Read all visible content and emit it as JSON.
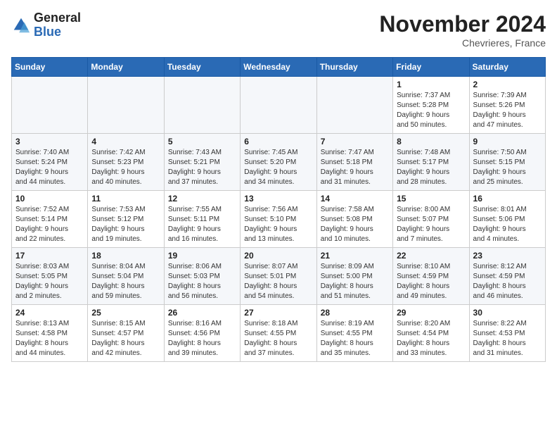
{
  "logo": {
    "general": "General",
    "blue": "Blue"
  },
  "header": {
    "month": "November 2024",
    "location": "Chevrieres, France"
  },
  "weekdays": [
    "Sunday",
    "Monday",
    "Tuesday",
    "Wednesday",
    "Thursday",
    "Friday",
    "Saturday"
  ],
  "weeks": [
    [
      {
        "day": "",
        "info": ""
      },
      {
        "day": "",
        "info": ""
      },
      {
        "day": "",
        "info": ""
      },
      {
        "day": "",
        "info": ""
      },
      {
        "day": "",
        "info": ""
      },
      {
        "day": "1",
        "info": "Sunrise: 7:37 AM\nSunset: 5:28 PM\nDaylight: 9 hours\nand 50 minutes."
      },
      {
        "day": "2",
        "info": "Sunrise: 7:39 AM\nSunset: 5:26 PM\nDaylight: 9 hours\nand 47 minutes."
      }
    ],
    [
      {
        "day": "3",
        "info": "Sunrise: 7:40 AM\nSunset: 5:24 PM\nDaylight: 9 hours\nand 44 minutes."
      },
      {
        "day": "4",
        "info": "Sunrise: 7:42 AM\nSunset: 5:23 PM\nDaylight: 9 hours\nand 40 minutes."
      },
      {
        "day": "5",
        "info": "Sunrise: 7:43 AM\nSunset: 5:21 PM\nDaylight: 9 hours\nand 37 minutes."
      },
      {
        "day": "6",
        "info": "Sunrise: 7:45 AM\nSunset: 5:20 PM\nDaylight: 9 hours\nand 34 minutes."
      },
      {
        "day": "7",
        "info": "Sunrise: 7:47 AM\nSunset: 5:18 PM\nDaylight: 9 hours\nand 31 minutes."
      },
      {
        "day": "8",
        "info": "Sunrise: 7:48 AM\nSunset: 5:17 PM\nDaylight: 9 hours\nand 28 minutes."
      },
      {
        "day": "9",
        "info": "Sunrise: 7:50 AM\nSunset: 5:15 PM\nDaylight: 9 hours\nand 25 minutes."
      }
    ],
    [
      {
        "day": "10",
        "info": "Sunrise: 7:52 AM\nSunset: 5:14 PM\nDaylight: 9 hours\nand 22 minutes."
      },
      {
        "day": "11",
        "info": "Sunrise: 7:53 AM\nSunset: 5:12 PM\nDaylight: 9 hours\nand 19 minutes."
      },
      {
        "day": "12",
        "info": "Sunrise: 7:55 AM\nSunset: 5:11 PM\nDaylight: 9 hours\nand 16 minutes."
      },
      {
        "day": "13",
        "info": "Sunrise: 7:56 AM\nSunset: 5:10 PM\nDaylight: 9 hours\nand 13 minutes."
      },
      {
        "day": "14",
        "info": "Sunrise: 7:58 AM\nSunset: 5:08 PM\nDaylight: 9 hours\nand 10 minutes."
      },
      {
        "day": "15",
        "info": "Sunrise: 8:00 AM\nSunset: 5:07 PM\nDaylight: 9 hours\nand 7 minutes."
      },
      {
        "day": "16",
        "info": "Sunrise: 8:01 AM\nSunset: 5:06 PM\nDaylight: 9 hours\nand 4 minutes."
      }
    ],
    [
      {
        "day": "17",
        "info": "Sunrise: 8:03 AM\nSunset: 5:05 PM\nDaylight: 9 hours\nand 2 minutes."
      },
      {
        "day": "18",
        "info": "Sunrise: 8:04 AM\nSunset: 5:04 PM\nDaylight: 8 hours\nand 59 minutes."
      },
      {
        "day": "19",
        "info": "Sunrise: 8:06 AM\nSunset: 5:03 PM\nDaylight: 8 hours\nand 56 minutes."
      },
      {
        "day": "20",
        "info": "Sunrise: 8:07 AM\nSunset: 5:01 PM\nDaylight: 8 hours\nand 54 minutes."
      },
      {
        "day": "21",
        "info": "Sunrise: 8:09 AM\nSunset: 5:00 PM\nDaylight: 8 hours\nand 51 minutes."
      },
      {
        "day": "22",
        "info": "Sunrise: 8:10 AM\nSunset: 4:59 PM\nDaylight: 8 hours\nand 49 minutes."
      },
      {
        "day": "23",
        "info": "Sunrise: 8:12 AM\nSunset: 4:59 PM\nDaylight: 8 hours\nand 46 minutes."
      }
    ],
    [
      {
        "day": "24",
        "info": "Sunrise: 8:13 AM\nSunset: 4:58 PM\nDaylight: 8 hours\nand 44 minutes."
      },
      {
        "day": "25",
        "info": "Sunrise: 8:15 AM\nSunset: 4:57 PM\nDaylight: 8 hours\nand 42 minutes."
      },
      {
        "day": "26",
        "info": "Sunrise: 8:16 AM\nSunset: 4:56 PM\nDaylight: 8 hours\nand 39 minutes."
      },
      {
        "day": "27",
        "info": "Sunrise: 8:18 AM\nSunset: 4:55 PM\nDaylight: 8 hours\nand 37 minutes."
      },
      {
        "day": "28",
        "info": "Sunrise: 8:19 AM\nSunset: 4:55 PM\nDaylight: 8 hours\nand 35 minutes."
      },
      {
        "day": "29",
        "info": "Sunrise: 8:20 AM\nSunset: 4:54 PM\nDaylight: 8 hours\nand 33 minutes."
      },
      {
        "day": "30",
        "info": "Sunrise: 8:22 AM\nSunset: 4:53 PM\nDaylight: 8 hours\nand 31 minutes."
      }
    ]
  ]
}
